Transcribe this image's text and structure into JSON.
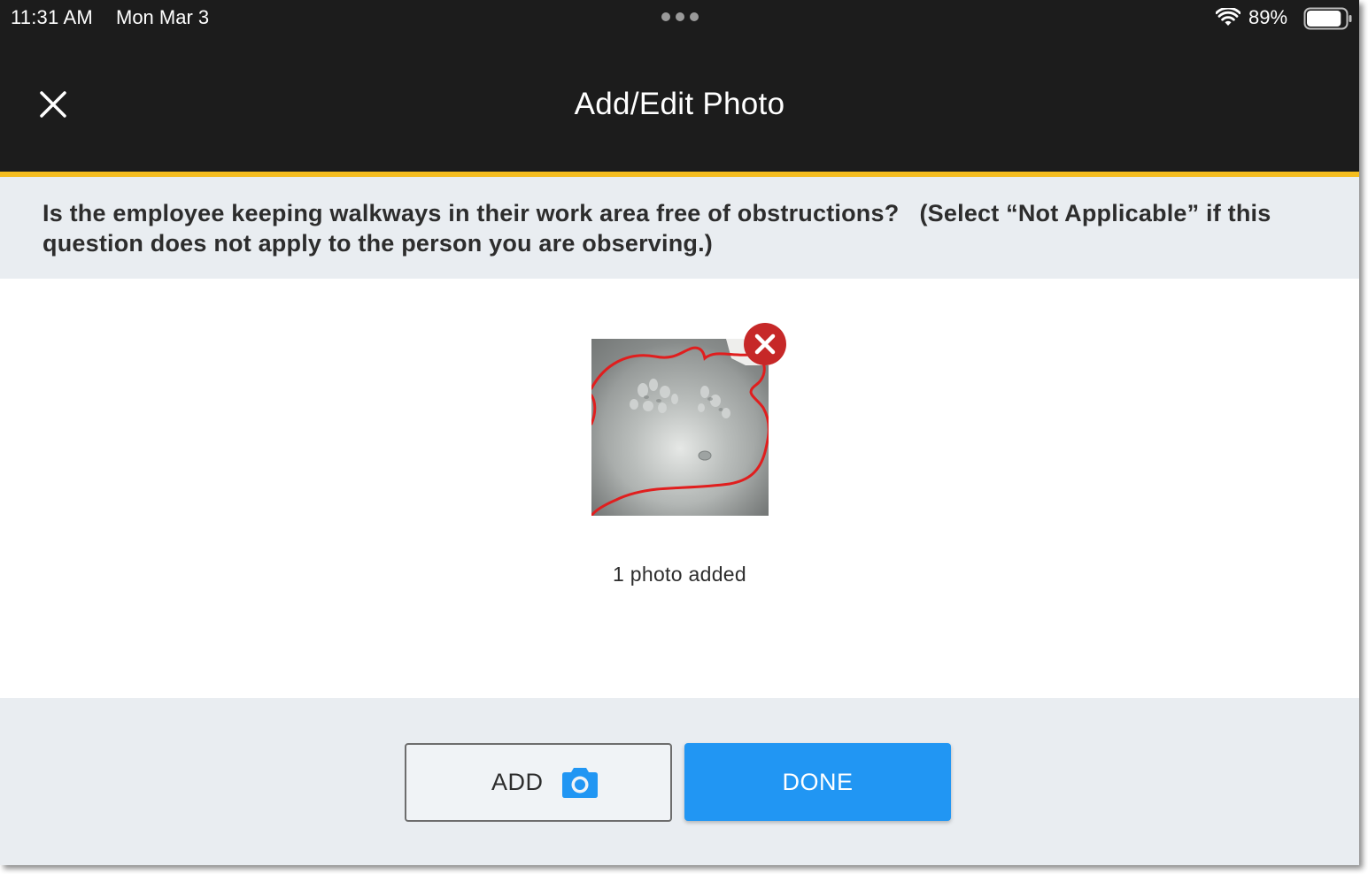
{
  "status_bar": {
    "time": "11:31 AM",
    "date": "Mon Mar 3",
    "battery_percent": "89%",
    "battery_level": 0.89,
    "icons": [
      "multitasking-dots-icon",
      "wifi-icon",
      "battery-icon"
    ]
  },
  "header": {
    "title": "Add/Edit Photo",
    "close_icon": "close-icon",
    "accent_color": "#f5bd1f",
    "background_color": "#1c1c1c"
  },
  "question": {
    "text": "Is the employee keeping walkways in their work area free of obstructions?   (Select “Not Applicable” if this question does not apply to the person you are observing.)"
  },
  "photos": {
    "count_label": "1 photo added",
    "items": [
      {
        "type": "photo",
        "remove_icon": "remove-photo-icon"
      }
    ]
  },
  "footer": {
    "add_label": "ADD",
    "add_icon": "camera-icon",
    "done_label": "DONE",
    "primary_color": "#2196f3",
    "remove_color": "#c62828"
  }
}
